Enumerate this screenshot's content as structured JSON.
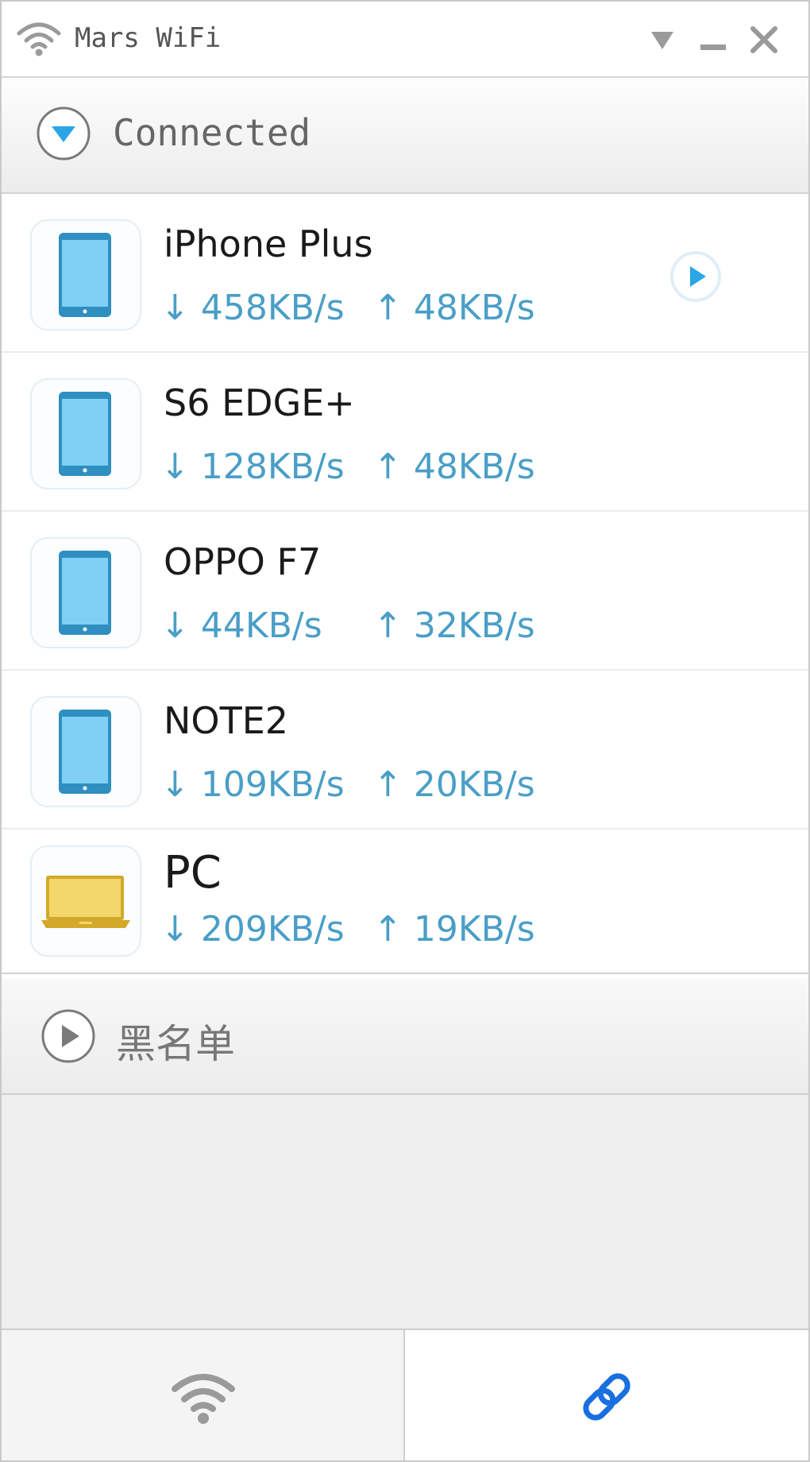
{
  "window": {
    "title": "Mars WiFi",
    "icons": [
      "wifi-icon",
      "dropdown-triangle-icon",
      "minimize-icon",
      "close-icon"
    ]
  },
  "connected_section": {
    "label": "Connected",
    "icon": "chevron-down-circle-icon",
    "expanded": true
  },
  "devices": [
    {
      "name": "iPhone Plus",
      "type": "tablet",
      "download": "458KB/s",
      "upload": "48KB/s",
      "has_play": true
    },
    {
      "name": "S6 EDGE+",
      "type": "tablet",
      "download": "128KB/s",
      "upload": "48KB/s"
    },
    {
      "name": "OPPO F7",
      "type": "tablet",
      "download": "44KB/s",
      "upload": "32KB/s"
    },
    {
      "name": "NOTE2",
      "type": "tablet",
      "download": "109KB/s",
      "upload": "20KB/s"
    },
    {
      "name": "PC",
      "type": "laptop",
      "download": "209KB/s",
      "upload": "19KB/s"
    }
  ],
  "blacklist_section": {
    "label": "黑名单",
    "icon": "play-circle-icon",
    "expanded": false
  },
  "tabs": [
    {
      "id": "wifi",
      "icon": "wifi-icon",
      "active": false
    },
    {
      "id": "link",
      "icon": "link-icon",
      "active": true
    }
  ],
  "colors": {
    "speed_text": "#4a9ec6",
    "tablet_fill": "#7fd0f4",
    "tablet_frame": "#2f8fc0",
    "laptop_fill": "#f2d76a",
    "link_active": "#1a6fe0",
    "wifi_inactive": "#9a9a9a"
  }
}
